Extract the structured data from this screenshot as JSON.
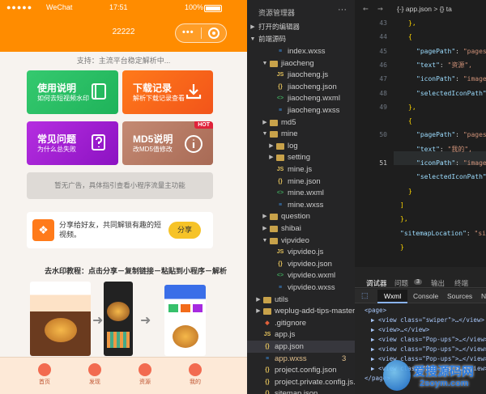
{
  "phone": {
    "status": {
      "carrier": "WeChat",
      "time": "17:51",
      "battery": "100%"
    },
    "nav_title": "22222",
    "notice": "支持：主流平台稳定解析中...",
    "cards": [
      {
        "title": "使用说明",
        "subtitle": "如何去短视频水印",
        "color": "#2ec36a",
        "icon": "book-icon"
      },
      {
        "title": "下载记录",
        "subtitle": "解析下载记录查看",
        "color": "#f56a1b",
        "icon": "download-icon"
      },
      {
        "title": "常见问题",
        "subtitle": "为什么总失败",
        "color": "#a620d0",
        "icon": "question-doc-icon"
      },
      {
        "title": "MD5说明",
        "subtitle": "改MD5值修改",
        "color": "#b87862",
        "icon": "info-icon",
        "badge": "HOT"
      }
    ],
    "ad": "暂无广告，具体指引查看小程序流量主功能",
    "share": {
      "text": "分享给好友，共同解锁有趣的短视频。",
      "button": "分享"
    },
    "tutorial_title": "去水印教程：点击分享－复制链接－粘贴到小程序－解析",
    "tabs": [
      "首页",
      "发现",
      "资源",
      "我的"
    ]
  },
  "explorer": {
    "title": "资源管理器",
    "more": "···",
    "section_open": "打开的编辑器",
    "section_project": "前端源码",
    "rows": [
      {
        "indent": 2,
        "type": "wxss",
        "name": "index.wxss"
      },
      {
        "indent": 1,
        "type": "folder-open",
        "name": "jiaocheng"
      },
      {
        "indent": 2,
        "type": "js",
        "name": "jiaocheng.js"
      },
      {
        "indent": 2,
        "type": "json",
        "name": "jiaocheng.json"
      },
      {
        "indent": 2,
        "type": "wxml",
        "name": "jiaocheng.wxml"
      },
      {
        "indent": 2,
        "type": "wxss",
        "name": "jiaocheng.wxss"
      },
      {
        "indent": 1,
        "type": "folder",
        "name": "md5"
      },
      {
        "indent": 1,
        "type": "folder-open",
        "name": "mine"
      },
      {
        "indent": 2,
        "type": "folder",
        "name": "log"
      },
      {
        "indent": 2,
        "type": "folder",
        "name": "setting"
      },
      {
        "indent": 2,
        "type": "js",
        "name": "mine.js"
      },
      {
        "indent": 2,
        "type": "json",
        "name": "mine.json"
      },
      {
        "indent": 2,
        "type": "wxml",
        "name": "mine.wxml"
      },
      {
        "indent": 2,
        "type": "wxss",
        "name": "mine.wxss"
      },
      {
        "indent": 1,
        "type": "folder",
        "name": "question"
      },
      {
        "indent": 1,
        "type": "folder",
        "name": "shibai"
      },
      {
        "indent": 1,
        "type": "folder-open",
        "name": "vipvideo"
      },
      {
        "indent": 2,
        "type": "js",
        "name": "vipvideo.js"
      },
      {
        "indent": 2,
        "type": "json",
        "name": "vipvideo.json"
      },
      {
        "indent": 2,
        "type": "wxml",
        "name": "vipvideo.wxml"
      },
      {
        "indent": 2,
        "type": "wxss",
        "name": "vipvideo.wxss"
      },
      {
        "indent": 0,
        "type": "folder",
        "name": "utils"
      },
      {
        "indent": 0,
        "type": "folder",
        "name": "weplug-add-tips-master"
      },
      {
        "indent": 0,
        "type": "git",
        "name": ".gitignore"
      },
      {
        "indent": 0,
        "type": "js",
        "name": "app.js"
      },
      {
        "indent": 0,
        "type": "json",
        "name": "app.json",
        "selected": true
      },
      {
        "indent": 0,
        "type": "wxss",
        "name": "app.wxss",
        "badge": "3",
        "modified": true
      },
      {
        "indent": 0,
        "type": "json",
        "name": "project.config.json"
      },
      {
        "indent": 0,
        "type": "json",
        "name": "project.private.config.js..."
      },
      {
        "indent": 0,
        "type": "json",
        "name": "sitemap.json"
      }
    ]
  },
  "editor": {
    "breadcrumb": "{-} app.json > {} ta",
    "lines": [
      {
        "n": "43",
        "code": "},"
      },
      {
        "n": "44",
        "code": "{"
      },
      {
        "n": "45",
        "k": "\"pagePath\"",
        "v": "\"pages"
      },
      {
        "n": "46",
        "k": "\"text\"",
        "v": "\"资源\","
      },
      {
        "n": "47",
        "k": "\"iconPath\"",
        "v": "\"image"
      },
      {
        "n": "48",
        "k": "\"selectedIconPath\"",
        "v": ""
      },
      {
        "n": "49",
        "code": "},"
      },
      {
        "n": "",
        "code": "{"
      },
      {
        "n": "50",
        "k": "\"pagePath\"",
        "v": "\"pages"
      },
      {
        "n": "",
        "k": "\"text\"",
        "v": "\"我的\","
      },
      {
        "n": "51",
        "k": "\"iconPath\"",
        "v": "\"image"
      },
      {
        "n": "",
        "k": "\"selectedIconPath\"",
        "v": ""
      },
      {
        "n": "",
        "code": "}"
      },
      {
        "n": "",
        "code": "]"
      },
      {
        "n": "",
        "code": "},"
      },
      {
        "n": "",
        "k": "\"sitemapLocation\"",
        "v": "\"site"
      },
      {
        "n": "",
        "code": "}"
      }
    ]
  },
  "devtools": {
    "tabs": [
      "调试器",
      "问题",
      "输出",
      "终端"
    ],
    "problems_count": "3",
    "subtabs": [
      "Wxml",
      "Console",
      "Sources",
      "N"
    ],
    "html": [
      "<page>",
      "▶ <view class=\"swiper\">…</view>",
      "▶ <view>…</view>",
      "▶ <view class=\"Pop-ups\">…</view>",
      "▶ <view class=\"Pop-ups\">…</view>",
      "▶ <view class=\"Pop-ups\">…</view>",
      "▶ <view class=\"Pop-ups\">…</view>",
      "</page>"
    ]
  },
  "watermark": {
    "text": "爱搜源码网",
    "url": "2soym.com"
  }
}
